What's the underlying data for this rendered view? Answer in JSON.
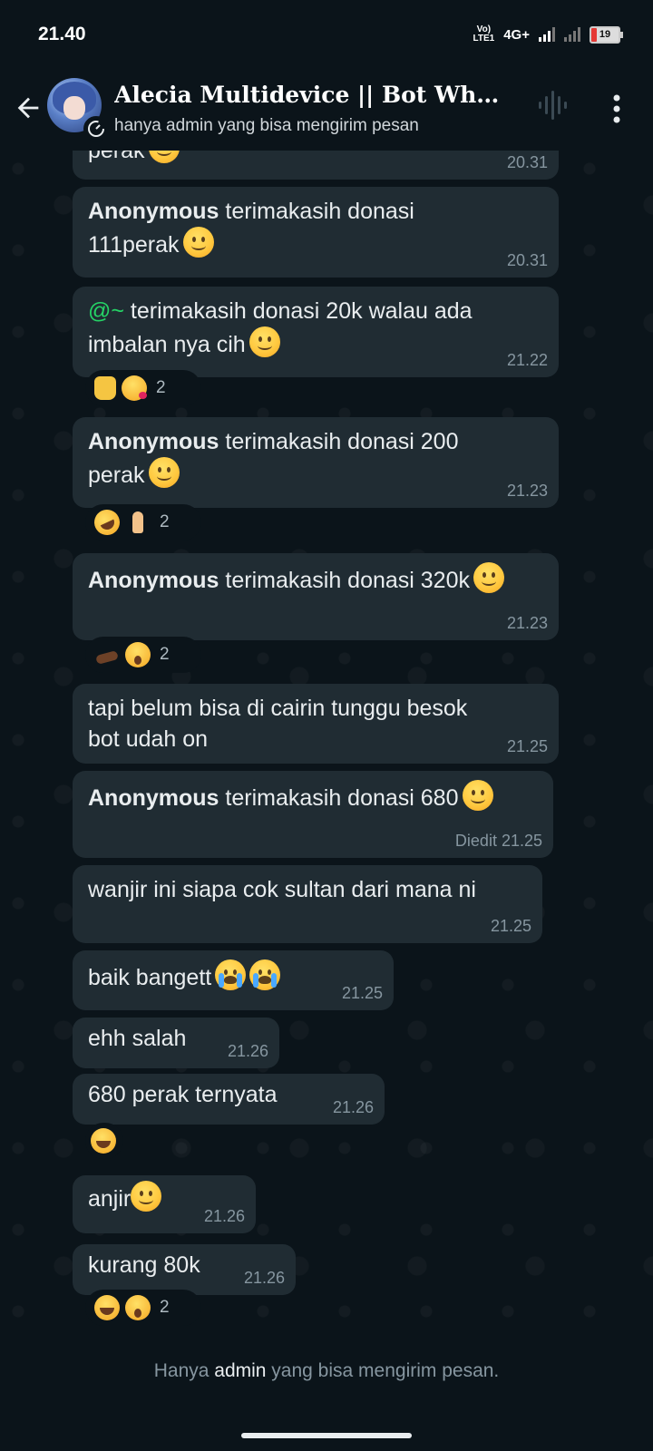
{
  "status_bar": {
    "time": "21.40",
    "volte": "Vo)) LTE1",
    "network": "4G+",
    "battery": "19",
    "battery_level": 0.19
  },
  "header": {
    "title": "Alecia Multidevice || Bot Whats...",
    "subtitle": "hanya admin yang bisa mengirim pesan"
  },
  "messages": [
    {
      "sender": "",
      "text": "perak",
      "emoji": true,
      "time": "20.31"
    },
    {
      "sender": "Anonymous",
      "text": " terimakasih donasi\n111perak",
      "emoji": true,
      "time": "20.31"
    },
    {
      "mention": "@~",
      "text": " terimakasih donasi 20k walau ada\nimbalan nya cih",
      "emoji": true,
      "time": "21.22",
      "reaction_count": "2"
    },
    {
      "sender": "Anonymous",
      "text": " terimakasih donasi 200\nperak",
      "emoji": true,
      "time": "21.23",
      "reaction_count": "2"
    },
    {
      "sender": "Anonymous",
      "text": " terimakasih donasi 320k",
      "emoji": true,
      "time": "21.23",
      "reaction_count": "2"
    },
    {
      "text": "tapi belum bisa di cairin tunggu besok\nbot udah on",
      "time": "21.25"
    },
    {
      "sender": "Anonymous",
      "text": " terimakasih donasi 680",
      "emoji": true,
      "time": "Diedit 21.25"
    },
    {
      "text": "wanjir ini siapa cok sultan dari mana ni",
      "time": "21.25"
    },
    {
      "text": "baik bangett",
      "time": "21.25"
    },
    {
      "text": "ehh salah",
      "time": "21.26"
    },
    {
      "text": "680 perak ternyata",
      "time": "21.26"
    },
    {
      "text": "anjir",
      "emoji": true,
      "time": "21.26"
    },
    {
      "text": "kurang 80k",
      "time": "21.26",
      "reaction_count": "2"
    }
  ],
  "footer": {
    "prefix": "Hanya ",
    "admin": "admin",
    "suffix": " yang bisa mengirim pesan."
  }
}
